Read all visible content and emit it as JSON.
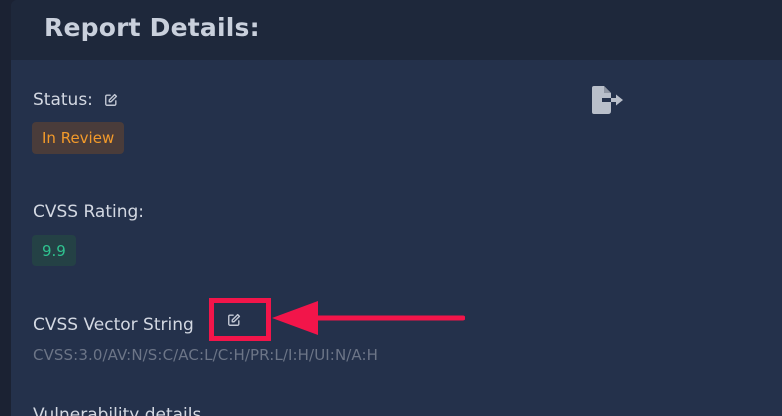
{
  "header": {
    "title": "Report Details:"
  },
  "status": {
    "label": "Status:",
    "value": "In Review",
    "edit_icon": "pencil-square-icon"
  },
  "cvss_rating": {
    "label": "CVSS Rating:",
    "value": "9.9"
  },
  "cvss_vector": {
    "label": "CVSS Vector String",
    "value": "CVSS:3.0/AV:N/S:C/AC:L/C:H/PR:L/I:H/UI:N/A:H",
    "edit_icon": "pencil-square-icon"
  },
  "next_section": {
    "label_partial": "Vulnerability details"
  },
  "toolbar": {
    "export_icon": "file-export-icon"
  },
  "annotation": {
    "highlight_color": "#f2154a"
  },
  "colors": {
    "status_badge_text": "#f39a2a",
    "cvss_badge_text": "#2fc28f"
  }
}
